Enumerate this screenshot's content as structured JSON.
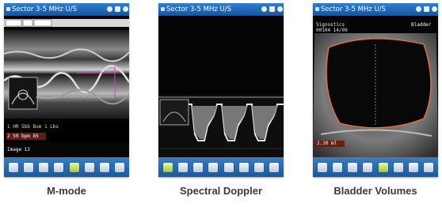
{
  "screens": [
    {
      "title": "Sector 3-5 MHz U/S",
      "caption": "M-mode",
      "meta_line1": "",
      "meta_line2": "",
      "stats": [
        "1 HR 5bb Bum 1 Lbs",
        "2 50 bpm 85"
      ],
      "image_label": "Image 13"
    },
    {
      "title": "Sector 3-5 MHz U/S",
      "caption": "Spectral Doppler"
    },
    {
      "title": "Sector 3-5 MHz U/S",
      "caption": "Bladder Volumes",
      "meta_line1": "Signostics",
      "meta_line2": "00104 14/09",
      "corner_label": "Bladder",
      "measure_label": "2.10 ml"
    }
  ],
  "colors": {
    "title_bar": "#1f66b8",
    "toolbar": "#2b6cb0",
    "caliper_pink": "#e040c0",
    "bladder_outline": "#e8703a"
  },
  "icons": [
    "mode-icon",
    "cine-icon",
    "measure-icon",
    "gain-icon",
    "freeze-icon",
    "zoom-icon",
    "save-icon",
    "menu-icon"
  ]
}
